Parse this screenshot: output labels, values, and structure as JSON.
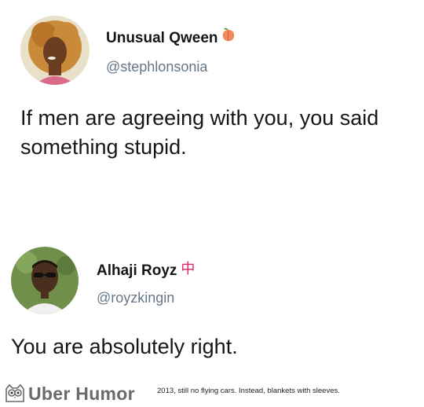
{
  "tweets": [
    {
      "display_name": "Unusual Qween",
      "handle": "@stephlonsonia",
      "name_emoji": "peach-icon",
      "text": "If men are agreeing with you, you said\nsomething stupid."
    },
    {
      "display_name": "Alhaji Royz",
      "handle": "@royzkingin",
      "name_badge": "中",
      "text": "You are absolutely right."
    }
  ],
  "footer": {
    "brand": "Uber Humor",
    "caption": "2013, still no flying cars. Instead, blankets with sleeves.",
    "logo_icon": "owl-logo-icon"
  },
  "colors": {
    "handle": "#657786",
    "text": "#14171a",
    "peach": "#f08a5d",
    "badge": "#e0245e",
    "brand": "#6a6a6a"
  }
}
